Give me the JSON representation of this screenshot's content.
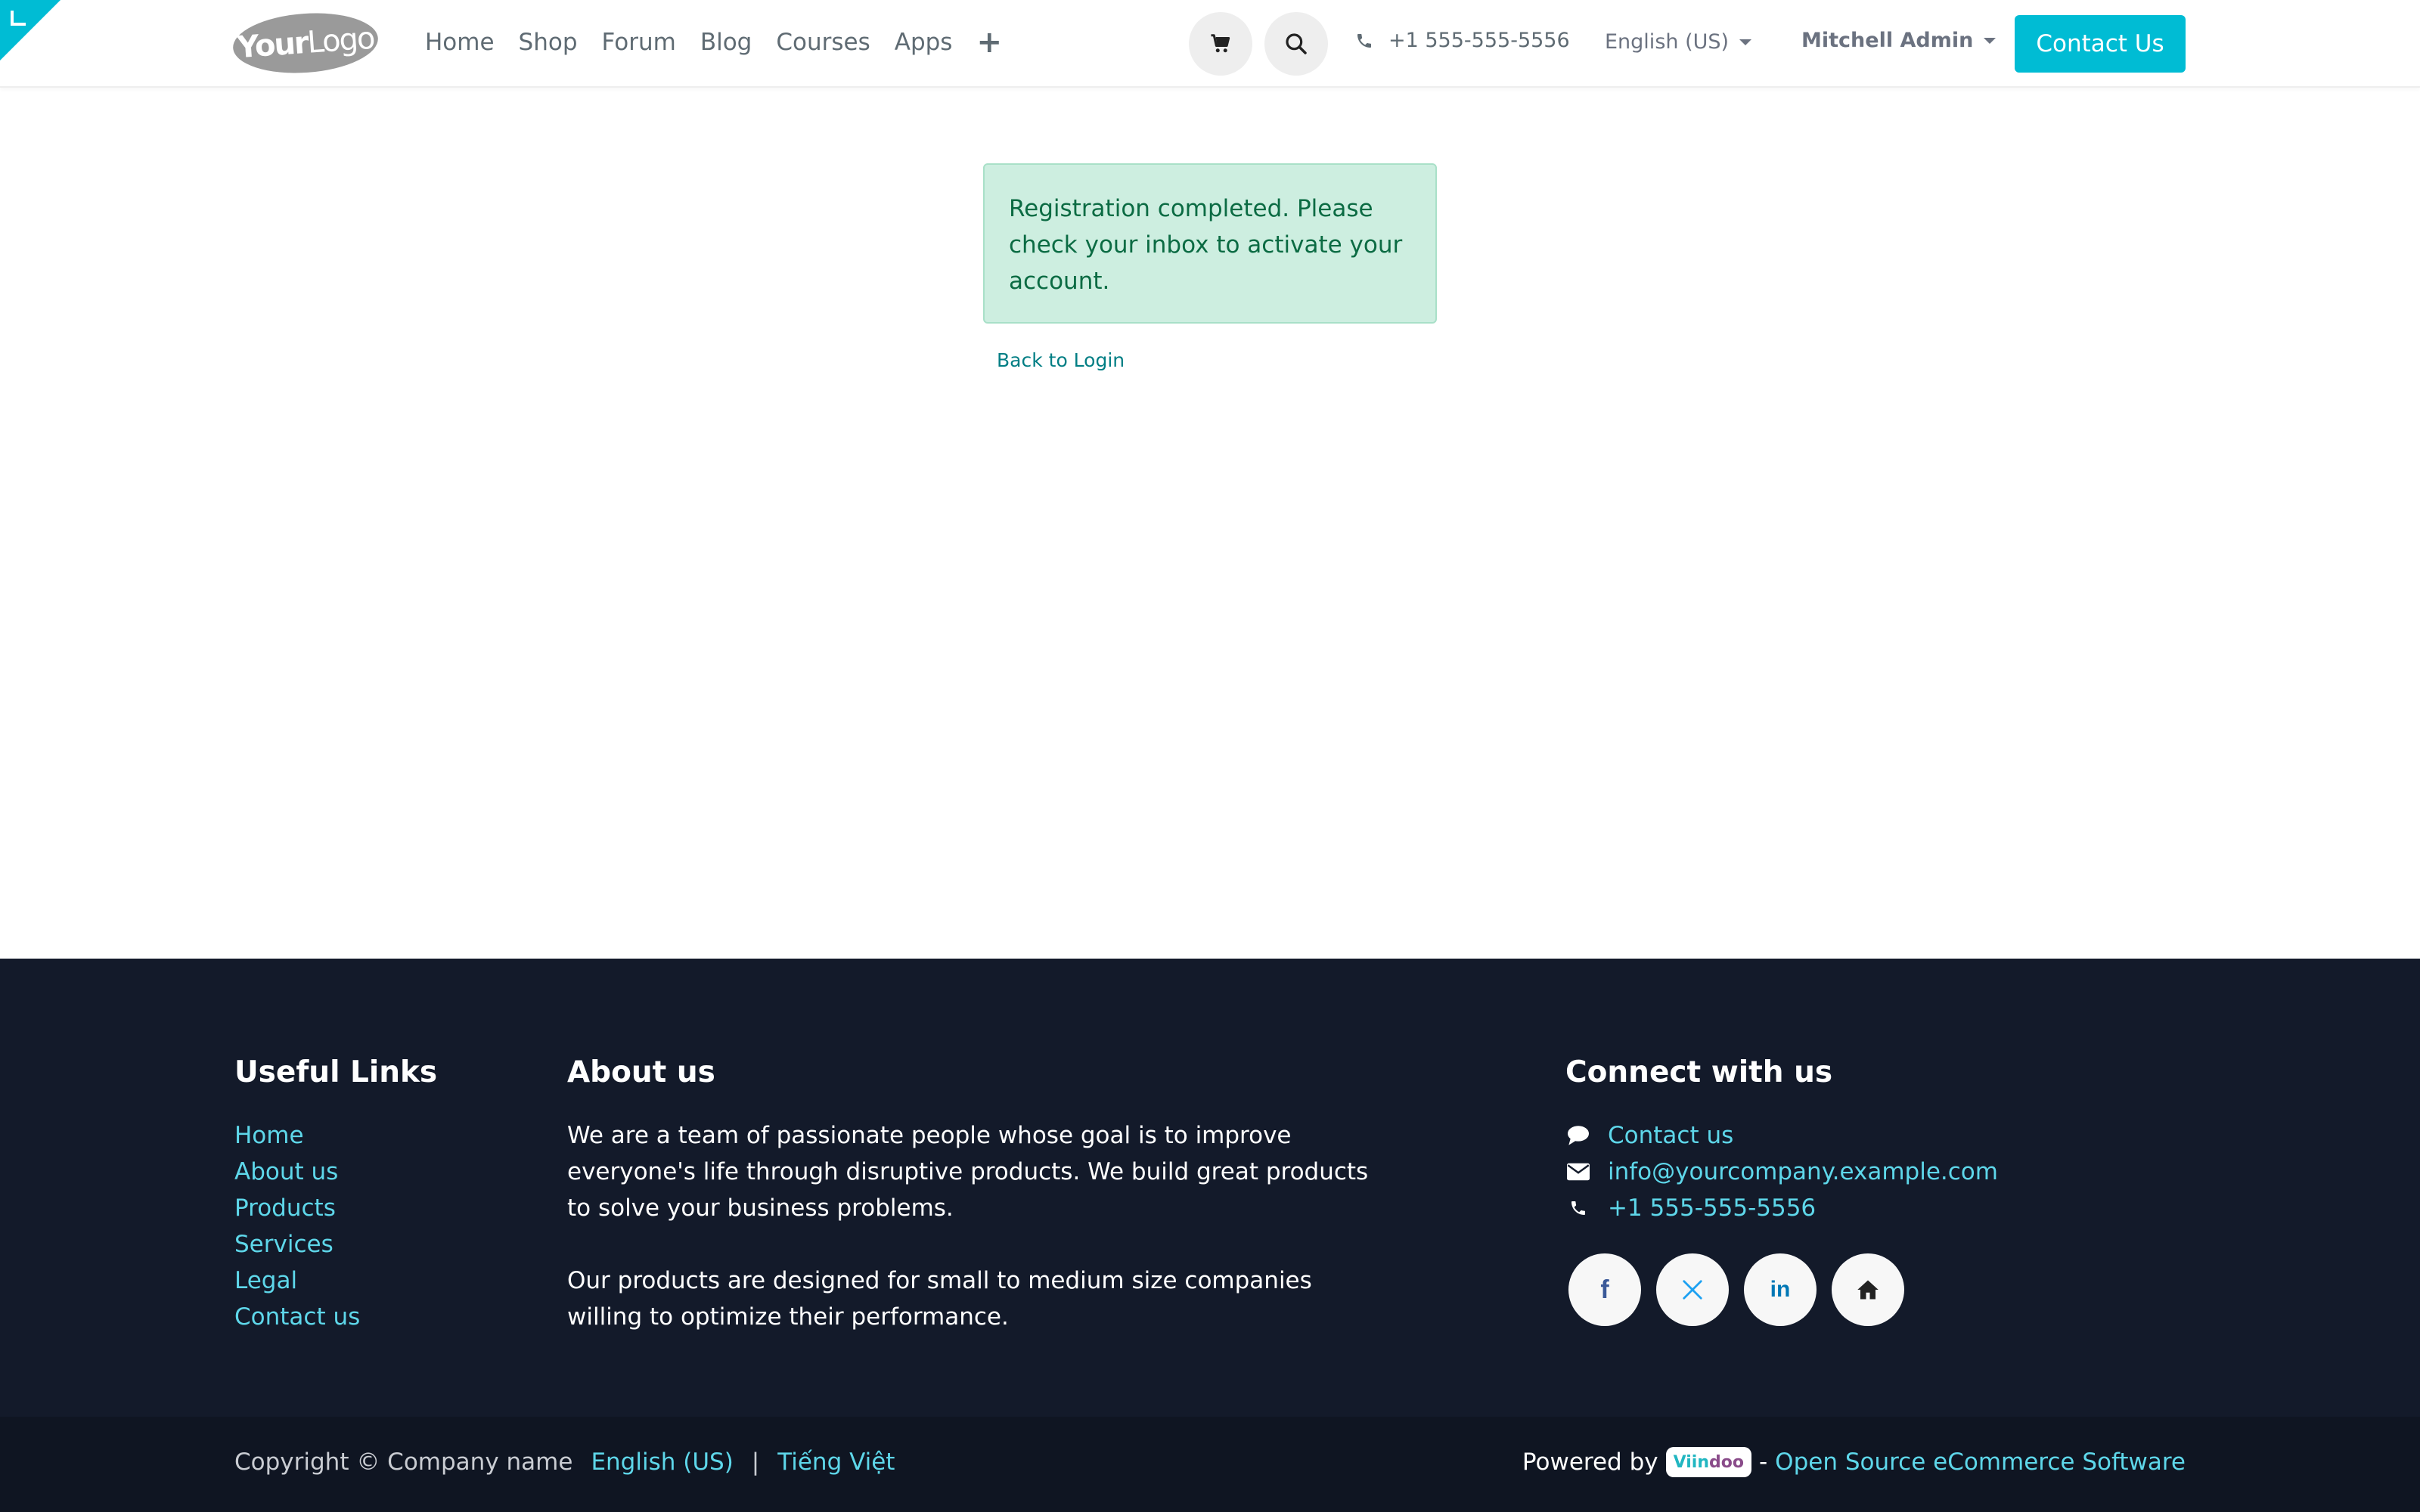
{
  "header": {
    "logo": {
      "part1": "Your",
      "part2": "Logo"
    },
    "nav": [
      "Home",
      "Shop",
      "Forum",
      "Blog",
      "Courses",
      "Apps"
    ],
    "phone": "+1 555-555-5556",
    "language": "English (US)",
    "user": "Mitchell Admin",
    "contact_button": "Contact Us"
  },
  "main": {
    "alert": "Registration completed. Please check your inbox to activate your account.",
    "back_link": "Back to Login"
  },
  "footer": {
    "useful_links": {
      "title": "Useful Links",
      "items": [
        "Home",
        "About us",
        "Products",
        "Services",
        "Legal",
        "Contact us"
      ]
    },
    "about": {
      "title": "About us",
      "paragraphs": [
        "We are a team of passionate people whose goal is to improve everyone's life through disruptive products. We build great products to solve your business problems.",
        "Our products are designed for small to medium size companies willing to optimize their performance."
      ]
    },
    "connect": {
      "title": "Connect with us",
      "contact": "Contact us",
      "email": "info@yourcompany.example.com",
      "phone": "+1 555-555-5556",
      "social_icons": [
        "facebook-icon",
        "x-icon",
        "linkedin-icon",
        "home-icon"
      ]
    },
    "bottom": {
      "copyright": "Copyright © Company name",
      "languages": [
        "English (US)",
        "Tiếng Việt"
      ],
      "separator": "|",
      "powered_by": "Powered by",
      "brand": {
        "part1": "Viin",
        "part2": "doo"
      },
      "dash": "-",
      "oss_link": "Open Source eCommerce Software"
    }
  },
  "colors": {
    "accent": "#00bcd4",
    "alert_bg": "#cdeee0",
    "alert_text": "#0b6b43",
    "footer_bg": "#131a2a",
    "link": "#5ed7ea"
  }
}
